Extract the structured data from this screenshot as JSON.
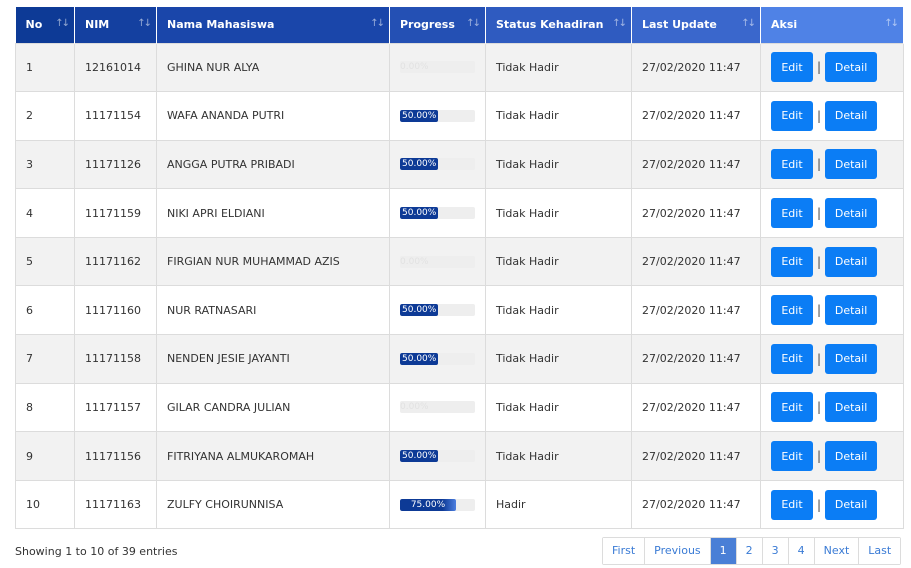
{
  "header": {
    "columns": [
      {
        "label": "No",
        "color": "#0d3a96",
        "width": 59
      },
      {
        "label": "NIM",
        "color": "#1440a0",
        "width": 82
      },
      {
        "label": "Nama Mahasiswa",
        "color": "#1a46aa",
        "width": 233
      },
      {
        "label": "Progress",
        "color": "#2450b4",
        "width": 96
      },
      {
        "label": "Status Kehadiran",
        "color": "#2f5bc0",
        "width": 146
      },
      {
        "label": "Last Update",
        "color": "#3a67cc",
        "width": 129
      },
      {
        "label": "Aksi",
        "color": "#4f82e6",
        "width": 143
      }
    ],
    "sort_glyph": "↑↓"
  },
  "rows": [
    {
      "no": "1",
      "nim": "12161014",
      "name": "GHINA NUR ALYA",
      "progress": 0,
      "progress_label": "0.00%",
      "status": "Tidak Hadir",
      "updated": "27/02/2020 11:47"
    },
    {
      "no": "2",
      "nim": "11171154",
      "name": "WAFA ANANDA PUTRI",
      "progress": 50,
      "progress_label": "50.00%",
      "status": "Tidak Hadir",
      "updated": "27/02/2020 11:47"
    },
    {
      "no": "3",
      "nim": "11171126",
      "name": "ANGGA PUTRA PRIBADI",
      "progress": 50,
      "progress_label": "50.00%",
      "status": "Tidak Hadir",
      "updated": "27/02/2020 11:47"
    },
    {
      "no": "4",
      "nim": "11171159",
      "name": "NIKI APRI ELDIANI",
      "progress": 50,
      "progress_label": "50.00%",
      "status": "Tidak Hadir",
      "updated": "27/02/2020 11:47"
    },
    {
      "no": "5",
      "nim": "11171162",
      "name": "FIRGIAN NUR MUHAMMAD AZIS",
      "progress": 0,
      "progress_label": "0.00%",
      "status": "Tidak Hadir",
      "updated": "27/02/2020 11:47"
    },
    {
      "no": "6",
      "nim": "11171160",
      "name": "NUR RATNASARI",
      "progress": 50,
      "progress_label": "50.00%",
      "status": "Tidak Hadir",
      "updated": "27/02/2020 11:47"
    },
    {
      "no": "7",
      "nim": "11171158",
      "name": "NENDEN JESIE JAYANTI",
      "progress": 50,
      "progress_label": "50.00%",
      "status": "Tidak Hadir",
      "updated": "27/02/2020 11:47"
    },
    {
      "no": "8",
      "nim": "11171157",
      "name": "GILAR CANDRA JULIAN",
      "progress": 0,
      "progress_label": "0.00%",
      "status": "Tidak Hadir",
      "updated": "27/02/2020 11:47"
    },
    {
      "no": "9",
      "nim": "11171156",
      "name": "FITRIYANA ALMUKAROMAH",
      "progress": 50,
      "progress_label": "50.00%",
      "status": "Tidak Hadir",
      "updated": "27/02/2020 11:47"
    },
    {
      "no": "10",
      "nim": "11171163",
      "name": "ZULFY CHOIRUNNISA",
      "progress": 75,
      "progress_label": "75.00%",
      "status": "Hadir",
      "updated": "27/02/2020 11:47"
    }
  ],
  "actions": {
    "edit_label": "Edit",
    "detail_label": "Detail",
    "separator": "|"
  },
  "footer": {
    "info": "Showing 1 to 10 of 39 entries"
  },
  "pagination": {
    "items": [
      "First",
      "Previous",
      "1",
      "2",
      "3",
      "4",
      "Next",
      "Last"
    ],
    "active": "1"
  },
  "colors": {
    "button": "#0b7df5",
    "progress_fill": "#0d3a96",
    "page_active": "#4a7fd6",
    "row_stripe": "#f2f2f2"
  }
}
